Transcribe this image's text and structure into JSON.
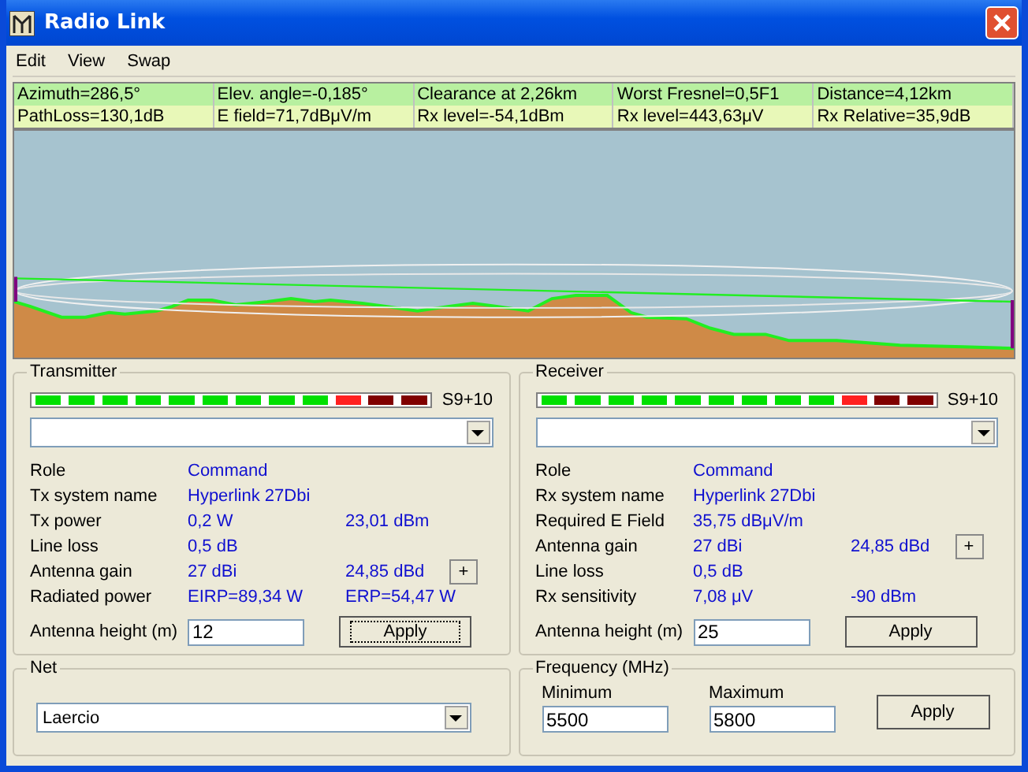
{
  "window": {
    "title": "Radio Link"
  },
  "menu": [
    "Edit",
    "View",
    "Swap"
  ],
  "info_rows": [
    {
      "cells": [
        "Azimuth=286,5°",
        "Elev. angle=-0,185°",
        "Clearance at 2,26km",
        "Worst Fresnel=0,5F1",
        "Distance=4,12km"
      ]
    },
    {
      "cells": [
        "PathLoss=130,1dB",
        "E field=71,7dBμV/m",
        "Rx level=-54,1dBm",
        "Rx level=443,63μV",
        "Rx Relative=35,9dB"
      ]
    }
  ],
  "panels": [
    {
      "title": "Transmitter",
      "meter": {
        "level": 0.833,
        "reading": "S9+10"
      },
      "rows": [
        {
          "label": "Role",
          "values": [
            "Command"
          ]
        },
        {
          "label": "Tx system name",
          "values": [
            "Hyperlink 27Dbi"
          ]
        },
        {
          "label": "Tx power",
          "values": [
            "0,2 W",
            "23,01 dBm"
          ]
        },
        {
          "label": "Line loss",
          "values": [
            "0,5 dB"
          ]
        },
        {
          "label": "Antenna gain",
          "values": [
            "27 dBi",
            "24,85 dBd"
          ],
          "button": "+"
        },
        {
          "label": "Radiated power",
          "values": [
            "EIRP=89,34 W",
            "ERP=54,47 W"
          ]
        }
      ],
      "height_label": "Antenna height (m)",
      "height_value": "12",
      "apply": {
        "label": "Apply",
        "focused": true
      }
    },
    {
      "title": "Receiver",
      "meter": {
        "level": 0.833,
        "reading": "S9+10"
      },
      "rows": [
        {
          "label": "Role",
          "values": [
            "Command"
          ]
        },
        {
          "label": "Rx system name",
          "values": [
            "Hyperlink 27Dbi"
          ]
        },
        {
          "label": "Required E Field",
          "values": [
            "35,75 dBμV/m"
          ]
        },
        {
          "label": "Antenna gain",
          "values": [
            "27 dBi",
            "24,85 dBd"
          ],
          "button": "+"
        },
        {
          "label": "Line loss",
          "values": [
            "0,5 dB"
          ]
        },
        {
          "label": "Rx sensitivity",
          "values": [
            "7,08 μV",
            "-90 dBm"
          ]
        }
      ],
      "height_label": "Antenna height (m)",
      "height_value": "25",
      "apply": {
        "label": "Apply",
        "focused": false
      }
    }
  ],
  "net": {
    "title": "Net",
    "value": "Laercio"
  },
  "frequency": {
    "title": "Frequency (MHz)",
    "min_label": "Minimum",
    "min_value": "5500",
    "max_label": "Maximum",
    "max_value": "5800",
    "apply": "Apply"
  }
}
